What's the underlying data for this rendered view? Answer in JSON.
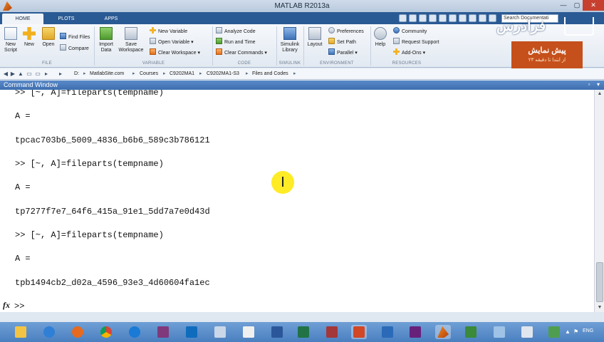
{
  "window": {
    "title": "MATLAB R2013a",
    "minimize": "—",
    "maximize": "▢",
    "close": "✕"
  },
  "tabs": [
    {
      "label": "HOME"
    },
    {
      "label": "PLOTS"
    },
    {
      "label": "APPS"
    }
  ],
  "search": {
    "placeholder": "Search Documentation",
    "value": "Search Documentati"
  },
  "ribbon": {
    "file": {
      "label": "FILE",
      "new_script": "New\nScript",
      "new": "New",
      "open": "Open",
      "find_files": "Find Files",
      "compare": "Compare"
    },
    "variable": {
      "label": "VARIABLE",
      "import_data": "Import\nData",
      "save_workspace": "Save\nWorkspace",
      "new_variable": "New Variable",
      "open_variable": "Open Variable",
      "clear_workspace": "Clear Workspace"
    },
    "code": {
      "label": "CODE",
      "analyze_code": "Analyze Code",
      "run_and_time": "Run and Time",
      "clear_commands": "Clear Commands"
    },
    "simulink": {
      "label": "SIMULINK",
      "simulink_library": "Simulink\nLibrary"
    },
    "environment": {
      "label": "ENVIRONMENT",
      "layout": "Layout",
      "preferences": "Preferences",
      "set_path": "Set Path",
      "parallel": "Parallel"
    },
    "resources": {
      "label": "RESOURCES",
      "help": "Help",
      "community": "Community",
      "request_support": "Request Support",
      "add_ons": "Add-Ons"
    }
  },
  "overlay": {
    "brand": "فرادرس",
    "promo_title": "پیش نمایش",
    "promo_sub": "از ابتدا تا دقیقه ۲۳"
  },
  "address": {
    "crumbs": [
      "D:",
      "MatlabSite.com",
      "Courses",
      "C9202MA1",
      "C9202MA1-S3",
      "Files and Codes"
    ]
  },
  "command_window": {
    "title": "Command Window",
    "lines": [
      ">> [~, A]=fileparts(tempname)",
      "A =",
      "tpcac703b6_5009_4836_b6b6_589c3b786121",
      ">> [~, A]=fileparts(tempname)",
      "A =",
      "tp7277f7e7_64f6_415a_91e1_5dd7a7e0d43d",
      ">> [~, A]=fileparts(tempname)",
      "A =",
      "tpb1494cb2_d02a_4596_93e3_4d60604fa1ec"
    ],
    "fx": "fx",
    "prompt": ">>"
  },
  "taskbar": {
    "apps": [
      "file-explorer",
      "onedrive",
      "firefox",
      "chrome",
      "internet-explorer",
      "onenote",
      "outlook",
      "notepad",
      "tex",
      "word",
      "excel",
      "access",
      "powerpoint",
      "visual-studio-code",
      "visual-studio",
      "matlab",
      "project",
      "app-17",
      "app-18",
      "paint"
    ],
    "language": "ENG"
  }
}
